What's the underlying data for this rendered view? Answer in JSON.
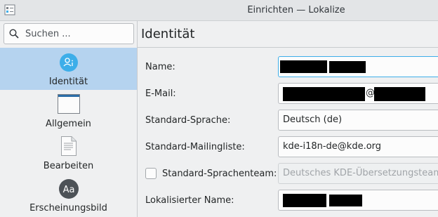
{
  "window": {
    "title": "Einrichten — Lokalize"
  },
  "search": {
    "placeholder": "Suchen ..."
  },
  "sidebar": {
    "items": [
      {
        "label": "Identität",
        "icon": "identity-icon",
        "selected": true
      },
      {
        "label": "Allgemein",
        "icon": "window-icon",
        "selected": false
      },
      {
        "label": "Bearbeiten",
        "icon": "document-icon",
        "selected": false
      },
      {
        "label": "Erscheinungsbild",
        "icon": "font-aa-icon",
        "selected": false
      }
    ]
  },
  "page": {
    "title": "Identität"
  },
  "form": {
    "name_label": "Name:",
    "email_label": "E-Mail:",
    "email_at": "@",
    "language_label": "Standard-Sprache:",
    "language_value": "Deutsch (de)",
    "mailinglist_label": "Standard-Mailingliste:",
    "mailinglist_value": "kde-i18n-de@kde.org",
    "team_label": "Standard-Sprachenteam:",
    "team_checked": false,
    "team_value": "Deutsches KDE-Übersetzungsteam",
    "localized_name_label": "Lokalisierter Name:"
  },
  "colors": {
    "accent": "#3daee9",
    "selection": "#b5d3ef",
    "identity_icon_bg": "#3daee9"
  }
}
